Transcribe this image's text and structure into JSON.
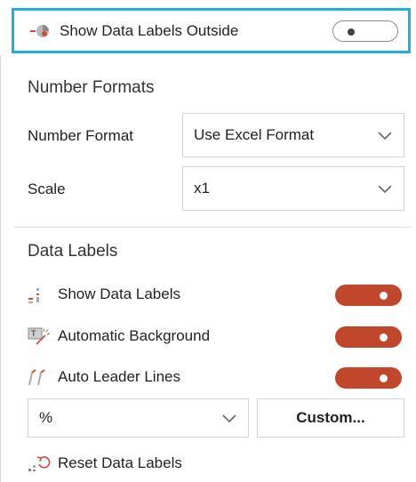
{
  "top_row": {
    "label": "Show Data Labels Outside",
    "toggle_state": "off"
  },
  "number_formats": {
    "section_title": "Number Formats",
    "number_format_label": "Number Format",
    "number_format_value": "Use Excel Format",
    "scale_label": "Scale",
    "scale_value": "x1"
  },
  "data_labels": {
    "section_title": "Data Labels",
    "show_data_labels": {
      "label": "Show Data Labels",
      "toggle_state": "on"
    },
    "automatic_background": {
      "label": "Automatic Background",
      "toggle_state": "on"
    },
    "auto_leader_lines": {
      "label": "Auto Leader Lines",
      "toggle_state": "on"
    },
    "format_value": "%",
    "custom_button_label": "Custom...",
    "reset_label": "Reset Data Labels"
  },
  "colors": {
    "accent_border": "#1fb0d6",
    "toggle_on": "#c0472b",
    "icon_red": "#d04a3a"
  }
}
